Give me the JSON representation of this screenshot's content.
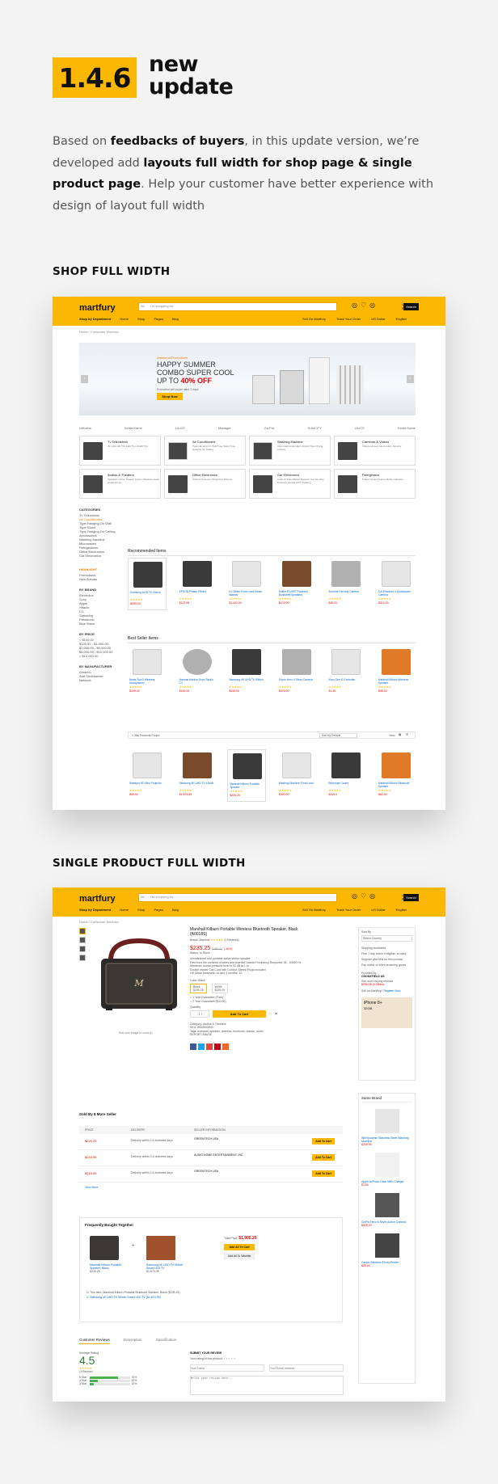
{
  "hero": {
    "version": "1.4.6",
    "title_line1": "new",
    "title_line2": "update"
  },
  "intro": {
    "p1": "Based on ",
    "b1": "feedbacks of buyers",
    "p2": ", in this update version, we’re developed add ",
    "b2": "layouts full width for shop page & single product page",
    "p3": ". Help your customer have better experience with design of layout full width"
  },
  "sections": {
    "shop": "SHOP FULL WIDTH",
    "single": "SINGLE PRODUCT FULL WIDTH"
  },
  "header": {
    "logo": "martfury",
    "search_placeholder": "I'm shopping for...",
    "search_category": "All",
    "search_button": "Search",
    "login": "Log in",
    "register": "Register",
    "shop_by_department": "Shop by Department",
    "nav": [
      "Home",
      "Shop",
      "Pages",
      "Blog"
    ],
    "nav_right": [
      "Sell On Martfury",
      "Track Your Order",
      "US Dollar",
      "English"
    ]
  },
  "shop": {
    "breadcrumb": "Home / Consumer Electrics",
    "banner": {
      "tag": "Weekend Promotions",
      "line1": "HAPPY SUMMER",
      "line2": "COMBO SUPER COOL",
      "line3": "UP TO ",
      "discount": "40% OFF",
      "desc": "Promotion will expire after 2 days",
      "button": "Shop Now"
    },
    "brands": [
      "rolltoline",
      "Kenta Kame",
      "LILIOT",
      "Manager",
      "Go Pro",
      "SUNCITY",
      "LILIOT",
      "Kenta Kame"
    ],
    "categories": [
      {
        "name": "Tv Televisions",
        "sub": "4K Ultra HD TVs LED TVs OLED TVs"
      },
      {
        "name": "Air Conditioners",
        "sub": "Type Hanging On Wall Type Stand Type Hanging On Ceiling"
      },
      {
        "name": "Washing Machine",
        "sub": "Apps Horizontal Apps Vertical Type Drying Clothes"
      },
      {
        "name": "Cameras & Videos",
        "sub": "Videos Lenses Camcorders Security"
      },
      {
        "name": "Audios & Theaters",
        "sub": "Speakers Home Theater System Wireless Audio Headphones"
      },
      {
        "name": "Office Electronics",
        "sub": "Printers Scanners Projectors Phones"
      },
      {
        "name": "Car Electronics",
        "sub": "Audio & Video Radar Detector Car Security Products Vehicle GPS Tracking"
      },
      {
        "name": "Refrigerator",
        "sub": "Fridge Cooler Freezer Bottle Cabinets"
      }
    ],
    "sidebar": {
      "categories_title": "CATEGORIES",
      "categories": [
        "Tv Televisions",
        "Air Conditioners",
        "Type Hanging On Wall",
        "Type Stand",
        "Type Hanging On Ceiling",
        "Accessories",
        "Washing Machine",
        "Microwaves",
        "Refrigerators",
        "Office Electronics",
        "Car Electronics"
      ],
      "highlight_title": "HIGHLIGHT",
      "highlight": [
        "Promotions",
        "New Arrivals"
      ],
      "brand_title": "BY BRAND",
      "brands": [
        "Electrolux",
        "Sony",
        "Apple",
        "Hitachi",
        "LG",
        "Samsung",
        "Panasonic",
        "Blue Wave"
      ],
      "price_title": "BY PRICE",
      "prices": [
        "< $100.00",
        "$100.00 - $1,000.00",
        "$1,000.00 - $5,000.00",
        "$5,000.00 - $10,000.00",
        "> $10,000.00"
      ],
      "manufacturer_title": "BY MANUFACTURER",
      "manufacturers": [
        "Amazon",
        "Add Smartsense",
        "Network"
      ]
    },
    "recommended_title": "Recommended Items",
    "recommended": [
      {
        "name": "Samsung UHD TV 24inch",
        "price": "$599.00"
      },
      {
        "name": "EPSON Plaster Printer",
        "price": "$122.99"
      },
      {
        "name": "LG White Front Load Steam Washer",
        "price": "$1,422.00"
      },
      {
        "name": "Edifier R1280T Powered Bookshelf Speakers",
        "price": "$129.00"
      },
      {
        "name": "Amcrest Security Camera",
        "price": "$45.00"
      },
      {
        "name": "DJI Phantom 4 Quadcopter Camera",
        "price": "$314.00"
      }
    ],
    "best_seller_title": "Best Seller Items",
    "best_seller": [
      {
        "name": "Beats Solo3 Wireless Headphones",
        "price": "$199.00"
      },
      {
        "name": "Harman Kardon Onyx Studio 2.0",
        "price": "$190.00"
      },
      {
        "name": "Samsung 4K UHD TV 55inch",
        "price": "$435.00"
      },
      {
        "name": "Gopro Hero 4 Silver Camera",
        "price": "$575.00"
      },
      {
        "name": "Xbox One S Controller",
        "price": "$1.35"
      },
      {
        "name": "Marshall Kilburn Wireless Speaker",
        "price": "$55.00"
      }
    ],
    "products_found": "2,366 Products Found",
    "sort": "Sort by Default",
    "view": "View",
    "grid_products": [
      {
        "name": "Sleekpro HD Mini Projector",
        "price": "$59.00"
      },
      {
        "name": "Samsung 4K UHD TV 43inch",
        "price": "$1,875.85"
      },
      {
        "name": "Marshall Kilburn Portable Speaker",
        "price": "$235.25"
      },
      {
        "name": "Washing Machine Front Load",
        "price": "$390.00"
      },
      {
        "name": "Beverage Cooler",
        "price": "$249.0"
      },
      {
        "name": "Marshall Kilburn Bluetooth Speaker",
        "price": "$62.00"
      }
    ]
  },
  "product": {
    "breadcrumb": "Home / Consumer Electrics",
    "title": "Marshall Kilburn Portable Wireless Bluetooth Speaker, Black (A0018S)",
    "brand": "Brand: Marshall",
    "reviews": "(1 Reviews)",
    "price": "$235.25",
    "old_price": "$280.00",
    "discount": "(-16%)",
    "status": "Status: In Stock",
    "features": [
      "Unrestrained and portable active stereo speaker",
      "Free from the confines of wires and chords/Channel Frequency Response 35 - 20000 Hz",
      "Maximum sound pressure level is 92 dB at 1 m",
      "Double woofer Call Cord with Control, Stereo Plugs included",
      "Off Genie Headsets: 4x and 4 months: 10"
    ],
    "color_label": "Color: Black",
    "colors": [
      {
        "name": "Black",
        "price": "$235.25"
      },
      {
        "name": "White",
        "price": "$235.25"
      }
    ],
    "warranty": [
      "1 Year Guarantee (Free)",
      "2 Year Guarantee ($30.00)"
    ],
    "quantity_label": "Quantity",
    "quantity": "1",
    "add_to_cart": "Add To Cart",
    "image_caption": "Roll over image to zoom in",
    "category": "Category: Audios & Theaters",
    "sku": "SKU: 8534543543",
    "tags": "Tags: marshall, speaker, wireless, bluetooth, classic, audio",
    "report": "REPORT ABUSE",
    "sidebar": {
      "sold_by": "Sold By",
      "sold_by_placeholder": "Select Country",
      "features": [
        "Shipping worldwide",
        "Free 7-day return if eligible, so easy",
        "Supplier give bills for this product",
        "Pay online or when receiving goods"
      ],
      "provided_by": "Provided by",
      "store": "CHONXFIELD US",
      "more_buying": "See more buying choices",
      "price_from": "$235.25 (3 Offers)",
      "sell_on": "Sell on Martfury?",
      "register": "Register Now",
      "promo_title": "iPhone 8+",
      "promo_sub": "32GB",
      "same_brand": "Same Brand",
      "same_brand_items": [
        {
          "name": "Whirlpoolmix Stainless Steel Washing Machine",
          "price": "$249.95"
        },
        {
          "name": "Apple AirPods Case With Charger",
          "price": "$1.50"
        },
        {
          "name": "GoPro Hero 6 Silver Action Camera",
          "price": "$325.00"
        },
        {
          "name": "Canon Wireless Photo Printer",
          "price": "$35.00"
        }
      ]
    },
    "more_sellers_title": "Sold By 8 More Seller",
    "more_sellers_headers": [
      "PRICE",
      "DELIVERY",
      "SELLER INFORMATION"
    ],
    "more_sellers": [
      {
        "price": "$220.25",
        "delivery": "Delivery within 3-6 business days",
        "seller": "GREENTECH USA",
        "button": "Add To Cart"
      },
      {
        "price": "$215.95",
        "delivery": "Delivery within 3-6 business days",
        "seller": "AUDIO HOME ENTERTAINMENT, INC",
        "button": "Add To Cart"
      },
      {
        "price": "$219.95",
        "delivery": "Delivery within 3-6 business days",
        "seller": "GREENTECH USA",
        "button": "Add To Cart"
      }
    ],
    "view_more": "View More",
    "fbt_title": "Frequently Bought Together",
    "fbt_total_label": "Total Price: ",
    "fbt_total": "$1,905.20",
    "fbt_add_all": "Add All To Cart",
    "fbt_wishlist": "Add All To Wishlist",
    "fbt_items": [
      {
        "name": "Marshall Kilburn Portable Speaker, Black",
        "price": "$235.25"
      },
      {
        "name": "Samsung 4K UHD TV 55inch Smart LED TV",
        "price": "$1,670.95"
      }
    ],
    "fbt_check1": "This Item: Marshall Kilburn Portable Bluetooth Speaker, Black ($235.25)",
    "fbt_check2": "Samsung 4K UHD TV 55inch Smart LED TV ($1,670.95)",
    "tabs": [
      "Customer Reviews",
      "Description",
      "Specification"
    ],
    "avg_label": "Average Rating",
    "avg": "4.5",
    "review_count": "(1 Review)",
    "bars": [
      {
        "label": "5 Star",
        "pct": 0.7,
        "text": "70%"
      },
      {
        "label": "4 Star",
        "pct": 0.2,
        "text": "20%"
      },
      {
        "label": "3 Star",
        "pct": 0.1,
        "text": "10%"
      }
    ],
    "submit_title": "SUBMIT YOUR REVIEW",
    "your_rating": "Your rating of this product",
    "name_ph": "Your Name",
    "email_ph": "Your Email Address",
    "review_ph": "Write your review here..."
  },
  "colors": {
    "accent": "#fcb800",
    "price": "#e60000",
    "link": "#0066cc"
  }
}
